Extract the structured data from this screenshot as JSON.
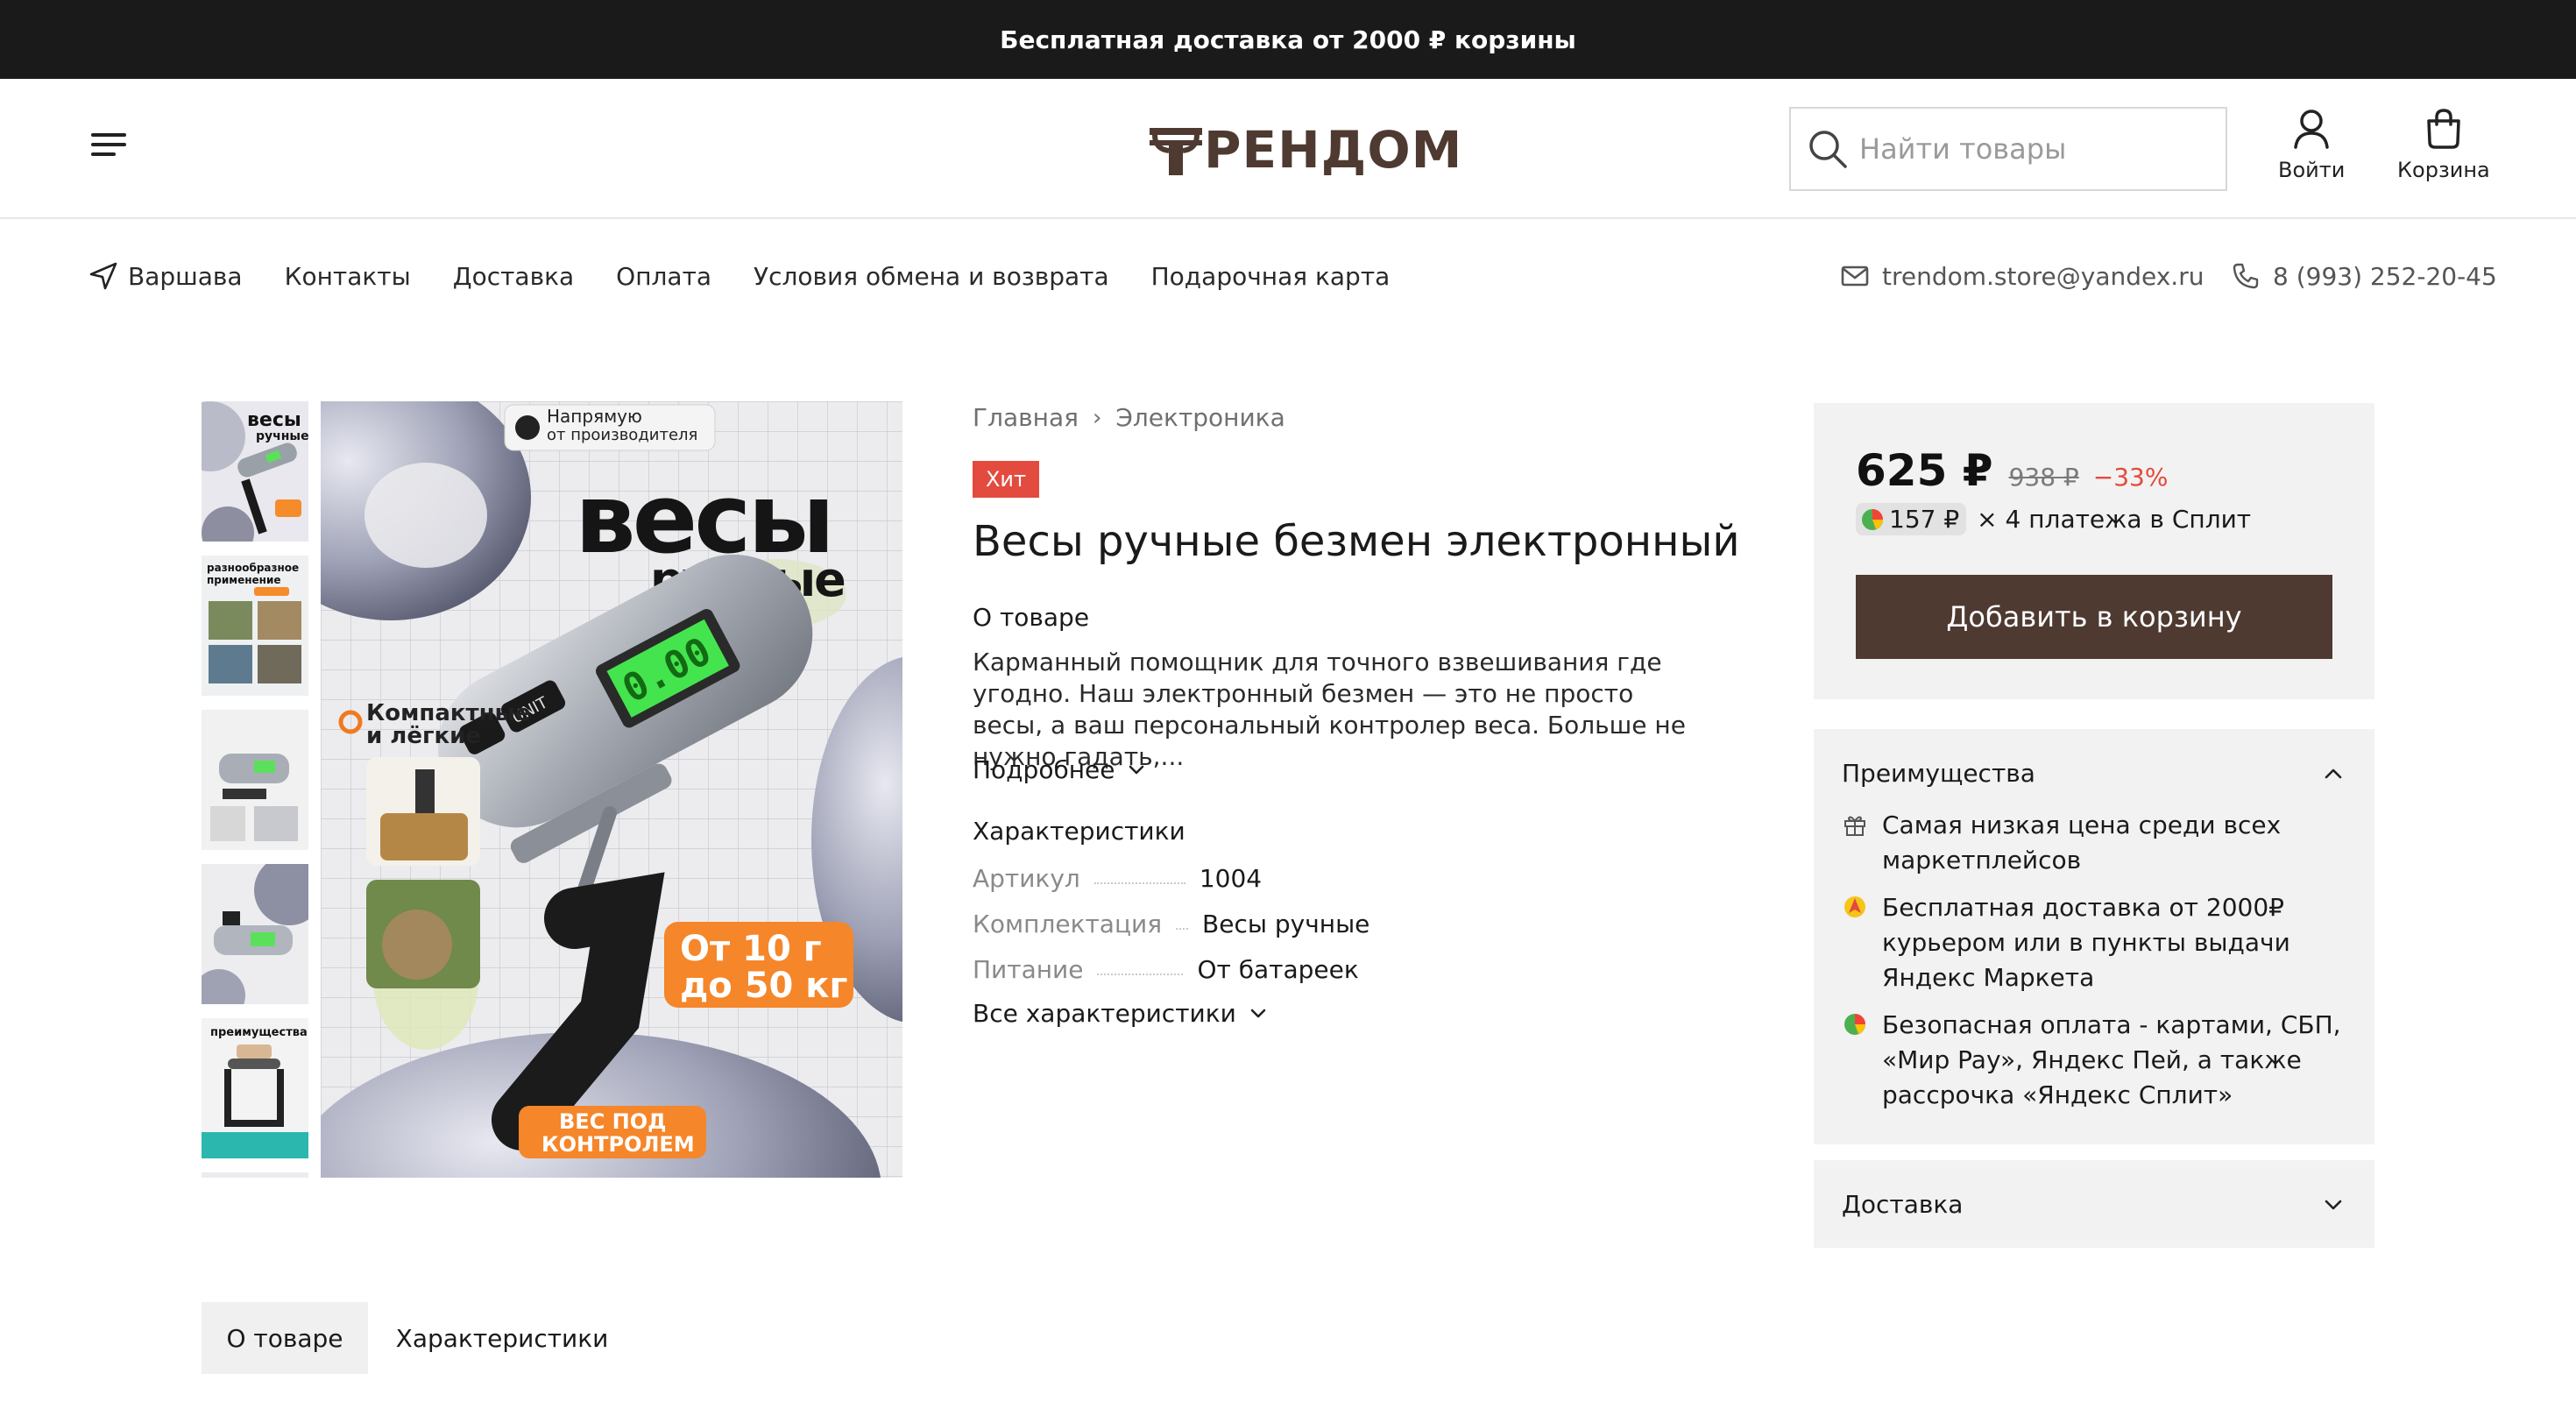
{
  "banner": {
    "text": "Бесплатная доставка от 2000 ₽ корзины"
  },
  "header": {
    "logo_text": "РЕНДОМ",
    "search": {
      "placeholder": "Найти товары",
      "value": ""
    },
    "login_label": "Войти",
    "cart_label": "Корзина"
  },
  "subnav": {
    "city": "Варшава",
    "links": [
      "Контакты",
      "Доставка",
      "Оплата",
      "Условия обмена и возврата",
      "Подарочная карта"
    ],
    "email": "trendom.store@yandex.ru",
    "phone": "8 (993) 252-20-45"
  },
  "gallery": {
    "thumb_labels": [
      "весы ручные",
      "разнообразное применение",
      "",
      "",
      "преимущества"
    ],
    "main": {
      "badge": "Напрямую от производителя",
      "headline_1": "весы",
      "headline_2": "ручные",
      "feature": "Компактные и лёгкие",
      "display": "0.00",
      "button_1": "UNIT",
      "range_1": "От 10 г",
      "range_2": "до 50 кг",
      "bottom_1": "ВЕС ПОД",
      "bottom_2": "КОНТРОЛЕМ"
    }
  },
  "product": {
    "breadcrumb": [
      "Главная",
      "Электроника"
    ],
    "badge": "Хит",
    "title": "Весы ручные безмен электронный",
    "about_heading": "О товаре",
    "description": "Карманный помощник для точного взвешивания где угодно. Наш электронный безмен — это не просто весы, а ваш персональный контролер веса. Больше не нужно гадать,...",
    "more_label": "Подробнее",
    "specs_heading": "Характеристики",
    "specs": [
      {
        "key": "Артикул",
        "value": "1004"
      },
      {
        "key": "Комплектация",
        "value": "Весы ручные"
      },
      {
        "key": "Питание",
        "value": "От батареек"
      }
    ],
    "all_specs_label": "Все характеристики"
  },
  "purchase": {
    "price": "625 ₽",
    "old_price": "938 ₽",
    "discount": "−33%",
    "split_amount": "157 ₽",
    "split_text": "× 4 платежа в Сплит",
    "add_to_cart": "Добавить в корзину"
  },
  "advantages": {
    "heading": "Преимущества",
    "items": [
      "Самая низкая цена среди всех маркетплейсов",
      "Бесплатная доставка от 2000₽ курьером или в пункты выдачи Яндекс Маркета",
      "Безопасная оплата - картами, СБП, «Мир Pay», Яндекс Пей, а также рассрочка «Яндекс Сплит»"
    ]
  },
  "delivery": {
    "heading": "Доставка"
  },
  "tabs": [
    "О товаре",
    "Характеристики"
  ],
  "colors": {
    "brand": "#4e3a31",
    "banner_bg": "#1a1a1a",
    "sale": "#e5493c",
    "hit_badge": "#e34b3f",
    "card_bg": "#f2f2f2"
  },
  "icons": [
    "menu-icon",
    "logo-mark-icon",
    "search-icon",
    "user-icon",
    "bag-icon",
    "location-arrow-icon",
    "mail-icon",
    "phone-icon",
    "chevron-down-icon",
    "chevron-up-icon",
    "gift-icon",
    "truck-badge-icon",
    "split-icon"
  ]
}
